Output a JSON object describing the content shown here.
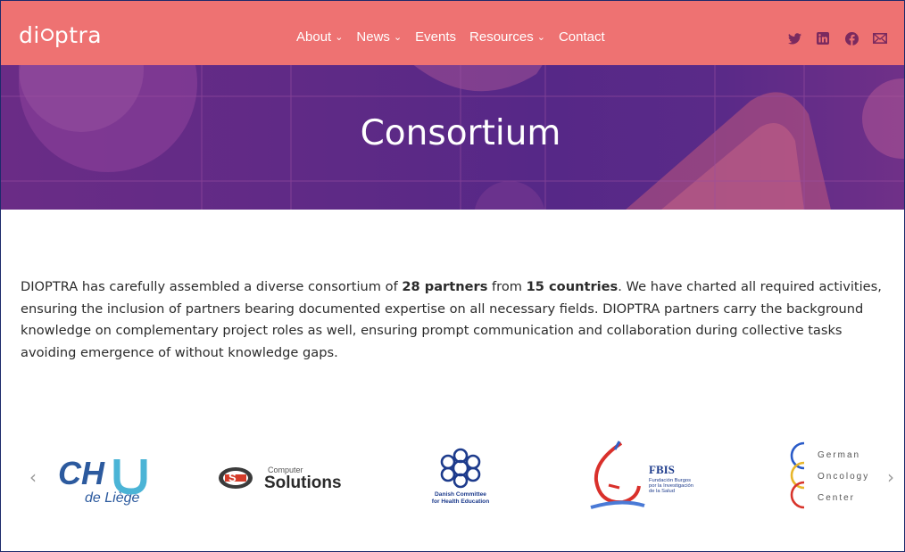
{
  "nav": {
    "logo_prefix": "di",
    "logo_suffix": "ptra",
    "items": [
      {
        "label": "About",
        "dropdown": true
      },
      {
        "label": "News",
        "dropdown": true
      },
      {
        "label": "Events",
        "dropdown": false
      },
      {
        "label": "Resources",
        "dropdown": true
      },
      {
        "label": "Contact",
        "dropdown": false
      }
    ],
    "chevron": "⌄",
    "social": [
      "twitter-icon",
      "linkedin-icon",
      "facebook-icon",
      "email-icon"
    ],
    "bg_color": "#ee7272"
  },
  "hero": {
    "title": "Consortium"
  },
  "intro": {
    "t1": "DIOPTRA has carefully assembled a diverse consortium of ",
    "partners": "28 partners",
    "t2": " from ",
    "countries": "15 countries",
    "t3": ". We have charted all required activities, ensuring the inclusion of partners bearing documented expertise on all necessary fields. DIOPTRA partners carry the background knowledge on complementary project roles as well, ensuring prompt communication and collaboration during collective tasks avoiding emergence of without knowledge gaps."
  },
  "carousel": {
    "prev": "‹",
    "next": "›",
    "partners": {
      "chu": {
        "top": "CHU",
        "bottom": "de Liège"
      },
      "cs": {
        "small": "Computer",
        "big": "Solutions"
      },
      "danish": {
        "line1": "Danish Committee",
        "line2": "for Health Education"
      },
      "fbis": {
        "name": "FBIS",
        "l1": "Fundación Burgos",
        "l2": "por la Investigación",
        "l3": "de la Salud"
      },
      "german": {
        "l1": "German",
        "l2": "Oncology",
        "l3": "Center"
      }
    }
  }
}
